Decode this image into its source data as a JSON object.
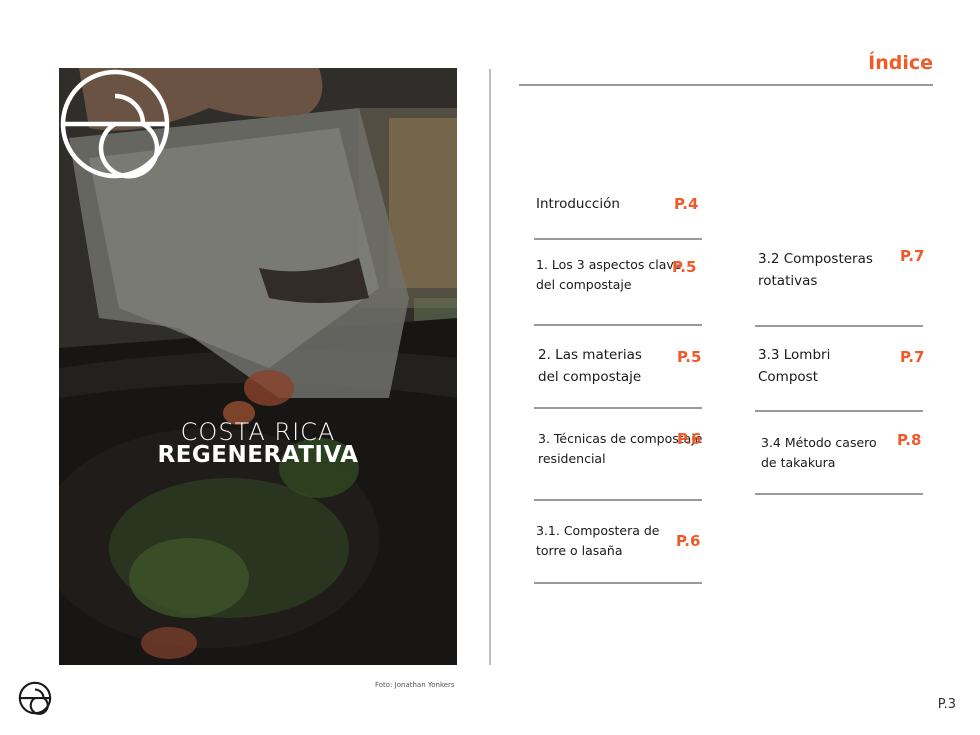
{
  "photo": {
    "brand_line1": "COSTA RICA",
    "brand_line2": "REGENERATIVA",
    "credit": "Foto: Jonathan Yonkers"
  },
  "index": {
    "title": "Índice",
    "entries": [
      {
        "label": "Introducción",
        "page": "P.4"
      },
      {
        "label": "1. Los 3 aspectos clave del compostaje",
        "page": "P.5"
      },
      {
        "label": "2. Las materias del compostaje",
        "page": "P.5"
      },
      {
        "label": "3. Técnicas de compostaje residencial",
        "page": "P.6"
      },
      {
        "label": "3.1. Compostera de torre o lasaña",
        "page": "P.6"
      },
      {
        "label": "3.2 Composteras rotativas",
        "page": "P.7"
      },
      {
        "label": "3.3 Lombri Compost",
        "page": "P.7"
      },
      {
        "label": "3.4 Método casero de takakura",
        "page": "P.8"
      }
    ]
  },
  "footer": {
    "page_number": "P.3",
    "logo_icon": "costa-rica-regenerativa-logo-icon"
  },
  "colors": {
    "accent": "#f05a28",
    "rule": "#9a9a9a"
  }
}
